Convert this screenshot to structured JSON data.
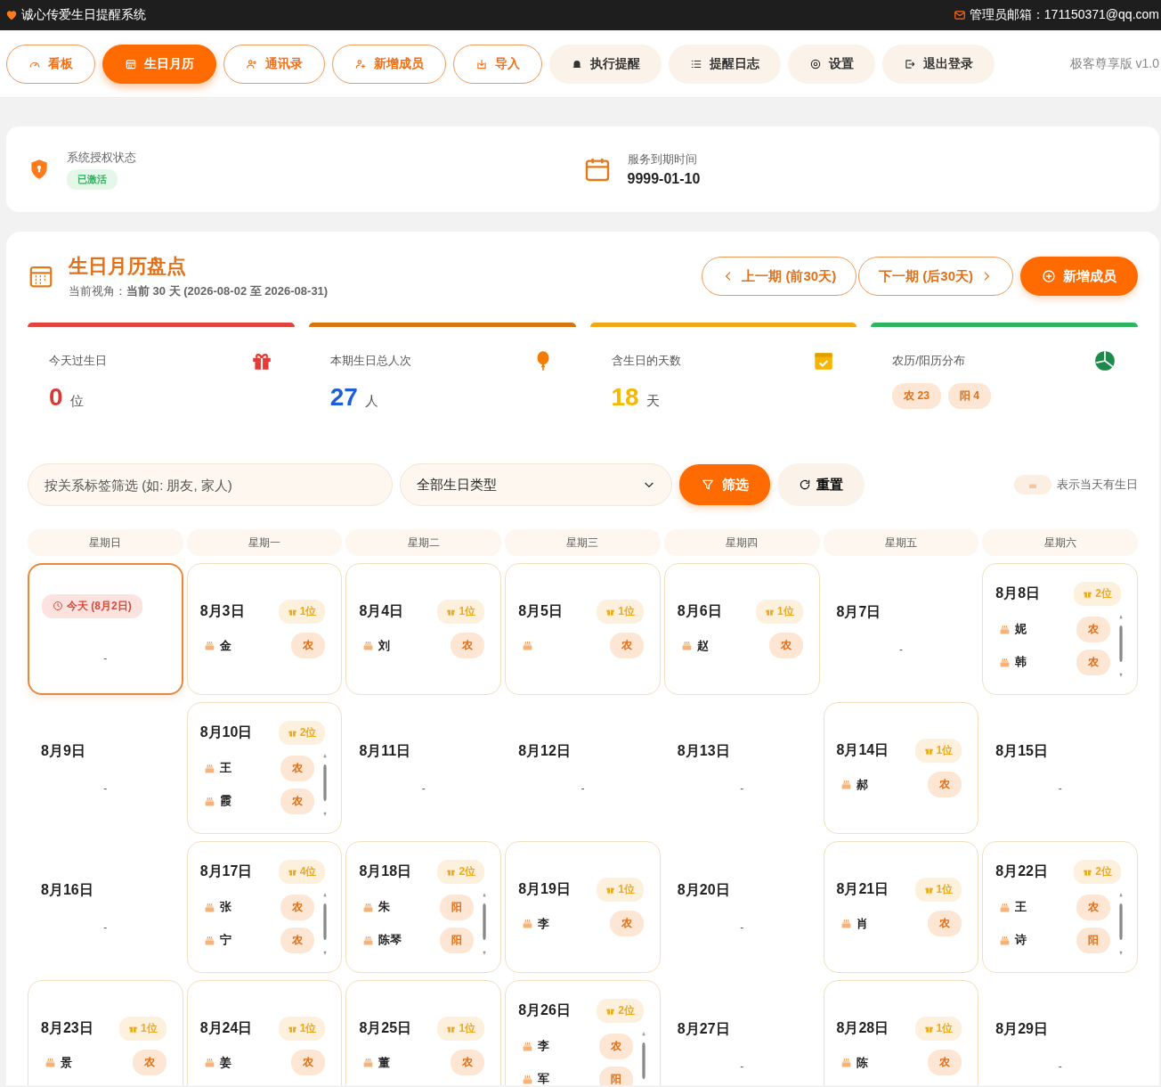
{
  "app": {
    "title": "诚心传爱生日提醒系统",
    "email": "管理员邮箱：171150371@qq.com"
  },
  "nav": [
    {
      "label": "看板",
      "kind": "outline",
      "selected": false
    },
    {
      "label": "生日月历",
      "kind": "outline",
      "selected": true
    },
    {
      "label": "通讯录",
      "kind": "outline",
      "selected": false
    },
    {
      "label": "新增成员",
      "kind": "outline",
      "selected": false
    },
    {
      "label": "导入",
      "kind": "outline",
      "selected": false
    },
    {
      "label": "执行提醒",
      "kind": "soft",
      "selected": false
    },
    {
      "label": "提醒日志",
      "kind": "soft",
      "selected": false
    },
    {
      "label": "设置",
      "kind": "soft",
      "selected": false
    },
    {
      "label": "退出登录",
      "kind": "soft",
      "selected": false
    }
  ],
  "edition": "极客尊享版 v1.0",
  "license": {
    "label": "系统授权状态",
    "status": "已激活",
    "expiry_label": "服务到期时间",
    "expiry": "9999-01-10"
  },
  "calendar": {
    "title": "生日月历盘点",
    "view_label": "当前视角：",
    "view": "当前 30 天 (2026-08-02 至 2026-08-31)",
    "prev": "上一期 (前30天)",
    "next": "下一期 (后30天)",
    "add": "新增成员"
  },
  "stats": [
    {
      "label": "今天过生日",
      "value": {
        "text": "0",
        "color": "#d63a35"
      },
      "unit": "位",
      "color": "#e0443e"
    },
    {
      "label": "本期生日总人次",
      "value": {
        "text": "27",
        "color": "#1e5fd8"
      },
      "unit": "人",
      "color": "#d9730f"
    },
    {
      "label": "含生日的天数",
      "value": {
        "text": "18",
        "color": "#f5b800"
      },
      "unit": "天",
      "color": "#f0a818"
    },
    {
      "label": "农历/阳历分布",
      "tags": [
        "农 23",
        "阳 4"
      ],
      "color": "#2db55d"
    }
  ],
  "filter": {
    "placeholder": "按关系标签筛选 (如: 朋友, 家人)",
    "type": "全部生日类型",
    "apply": "筛选",
    "reset": "重置",
    "legend": "表示当天有生日"
  },
  "weekdays": [
    "星期日",
    "星期一",
    "星期二",
    "星期三",
    "星期四",
    "星期五",
    "星期六"
  ],
  "weeks": [
    [
      {
        "today": true,
        "badge": "今天 (8月2日)",
        "empty": "-"
      },
      {
        "date": "8月3日",
        "count": "1位",
        "people": [
          {
            "name": "金",
            "tag": "农"
          }
        ]
      },
      {
        "date": "8月4日",
        "count": "1位",
        "people": [
          {
            "name": "刘",
            "tag": "农"
          }
        ]
      },
      {
        "date": "8月5日",
        "count": "1位",
        "people": [
          {
            "tag": "农"
          }
        ]
      },
      {
        "date": "8月6日",
        "count": "1位",
        "people": [
          {
            "name": "赵",
            "tag": "农"
          }
        ]
      },
      {
        "date": "8月7日",
        "empty": "-"
      },
      {
        "date": "8月8日",
        "count": "2位",
        "people": [
          {
            "name": "妮",
            "tag": "农"
          },
          {
            "name": "韩",
            "tag": "农"
          }
        ]
      }
    ],
    [
      {
        "date": "8月9日",
        "empty": "-"
      },
      {
        "date": "8月10日",
        "count": "2位",
        "people": [
          {
            "name": "王",
            "tag": "农"
          },
          {
            "name": "霞",
            "tag": "农"
          }
        ]
      },
      {
        "date": "8月11日",
        "empty": "-"
      },
      {
        "date": "8月12日",
        "empty": "-"
      },
      {
        "date": "8月13日",
        "empty": "-"
      },
      {
        "date": "8月14日",
        "count": "1位",
        "people": [
          {
            "name": "郝",
            "tag": "农"
          }
        ]
      },
      {
        "date": "8月15日",
        "empty": "-"
      }
    ],
    [
      {
        "date": "8月16日",
        "empty": "-"
      },
      {
        "date": "8月17日",
        "count": "4位",
        "people": [
          {
            "name": "张",
            "tag": "农"
          },
          {
            "name": "宁",
            "tag": "农"
          }
        ]
      },
      {
        "date": "8月18日",
        "count": "2位",
        "people": [
          {
            "name": "朱",
            "tag": "阳"
          },
          {
            "name": "陈琴",
            "tag": "阳"
          }
        ]
      },
      {
        "date": "8月19日",
        "count": "1位",
        "people": [
          {
            "name": "李",
            "tag": "农"
          }
        ]
      },
      {
        "date": "8月20日",
        "empty": "-"
      },
      {
        "date": "8月21日",
        "count": "1位",
        "people": [
          {
            "name": "肖",
            "tag": "农"
          }
        ]
      },
      {
        "date": "8月22日",
        "count": "2位",
        "people": [
          {
            "name": "王",
            "tag": "农"
          },
          {
            "name": "诗",
            "tag": "阳"
          }
        ]
      }
    ],
    [
      {
        "date": "8月23日",
        "count": "1位",
        "people": [
          {
            "name": "景",
            "tag": "农"
          }
        ]
      },
      {
        "date": "8月24日",
        "count": "1位",
        "people": [
          {
            "name": "姜",
            "tag": "农"
          }
        ]
      },
      {
        "date": "8月25日",
        "count": "1位",
        "people": [
          {
            "name": "董",
            "tag": "农"
          }
        ]
      },
      {
        "date": "8月26日",
        "count": "2位",
        "people": [
          {
            "name": "李",
            "tag": "农"
          },
          {
            "name": "军",
            "tag": "阳"
          }
        ]
      },
      {
        "date": "8月27日",
        "empty": "-"
      },
      {
        "date": "8月28日",
        "count": "1位",
        "people": [
          {
            "name": "陈",
            "tag": "农"
          }
        ]
      },
      {
        "date": "8月29日",
        "empty": "-"
      }
    ]
  ]
}
